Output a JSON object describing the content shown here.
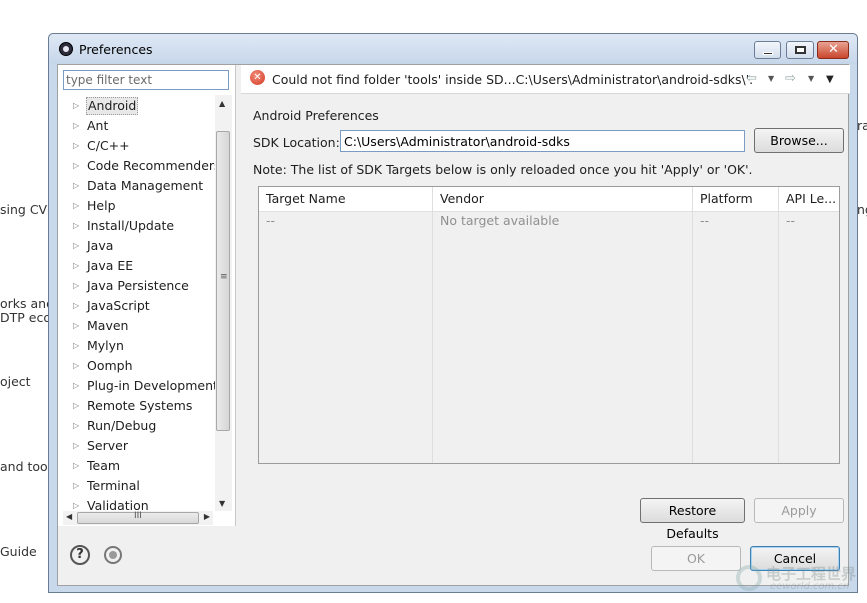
{
  "background_texts": [
    "sing CVS",
    "orks and",
    "DTP eco",
    "oject",
    "and tool",
    "Guide",
    "ra",
    "ng"
  ],
  "window": {
    "title": "Preferences",
    "icon": "eclipse-gear-icon"
  },
  "filter": {
    "placeholder": "type filter text"
  },
  "tree": {
    "items": [
      "Android",
      "Ant",
      "C/C++",
      "Code Recommenders",
      "Data Management",
      "Help",
      "Install/Update",
      "Java",
      "Java EE",
      "Java Persistence",
      "JavaScript",
      "Maven",
      "Mylyn",
      "Oomph",
      "Plug-in Development",
      "Remote Systems",
      "Run/Debug",
      "Server",
      "Team",
      "Terminal",
      "Validation"
    ],
    "selected": "Android",
    "vscroll_grip": "≡",
    "hscroll_grip": "III"
  },
  "error": {
    "icon": "error-x-icon",
    "message": "Could not find folder 'tools' inside SD...C:\\Users\\Administrator\\android-sdks\\'."
  },
  "page": {
    "title": "Android Preferences",
    "sdk_label": "SDK Location:",
    "sdk_value": "C:\\Users\\Administrator\\android-sdks",
    "browse_label": "Browse...",
    "note": "Note: The list of SDK Targets below is only reloaded once you hit 'Apply' or 'OK'."
  },
  "table": {
    "columns": [
      "Target Name",
      "Vendor",
      "Platform",
      "API Le..."
    ],
    "rows": [
      [
        "--",
        "No target available",
        "--",
        "--"
      ]
    ]
  },
  "buttons": {
    "restore_defaults": "Restore Defaults",
    "apply": "Apply",
    "ok": "OK",
    "cancel": "Cancel"
  },
  "watermark": {
    "text": "电子工程世界",
    "sub": "eeworld.com.cn"
  }
}
